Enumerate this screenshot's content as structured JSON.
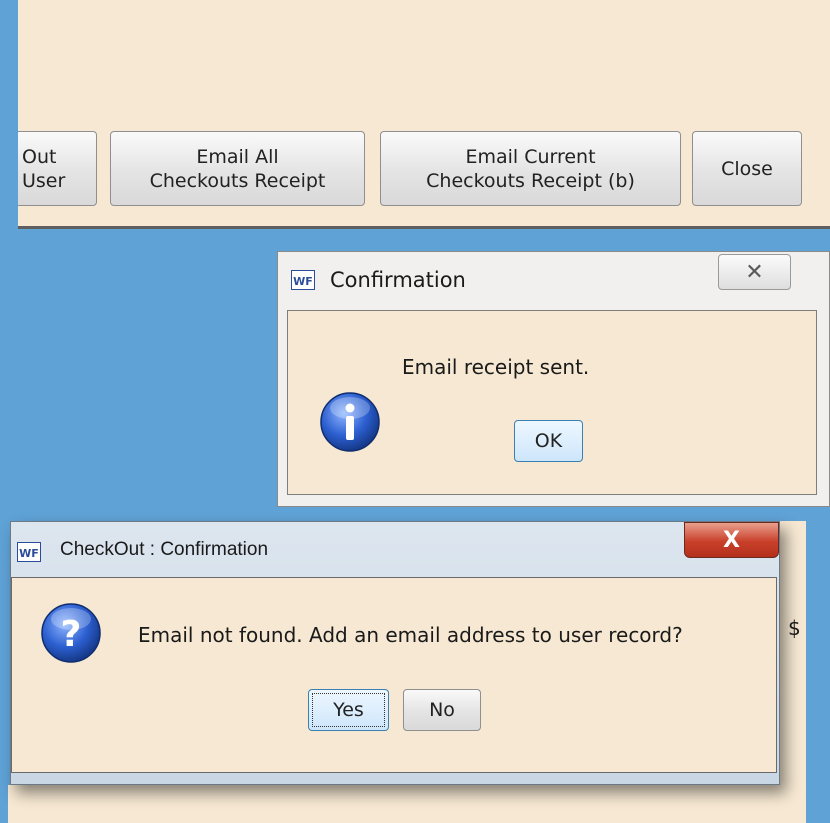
{
  "toolbar": {
    "partial_button": {
      "line1": "Out",
      "line2": "User"
    },
    "email_all": {
      "line1": "Email All",
      "line2": "Checkouts Receipt"
    },
    "email_current": {
      "line1": "Email Current",
      "line2": "Checkouts Receipt (b)"
    },
    "close": "Close"
  },
  "dialog_receipt": {
    "app_icon": "WF",
    "title": "Confirmation",
    "close_glyph": "✕",
    "icon": "info-icon",
    "message": "Email receipt sent.",
    "ok_label": "OK"
  },
  "dialog_not_found": {
    "app_icon": "WF",
    "title": "CheckOut : Confirmation",
    "close_glyph": "X",
    "icon": "question-icon",
    "message": "Email not found. Add an email address to user record?",
    "yes_label": "Yes",
    "no_label": "No",
    "background_peek": "$"
  },
  "colors": {
    "desktop": "#5fa2d6",
    "panel": "#f6e8d2",
    "close_red": "#c9402a",
    "icon_blue": "#1f4fb8"
  }
}
